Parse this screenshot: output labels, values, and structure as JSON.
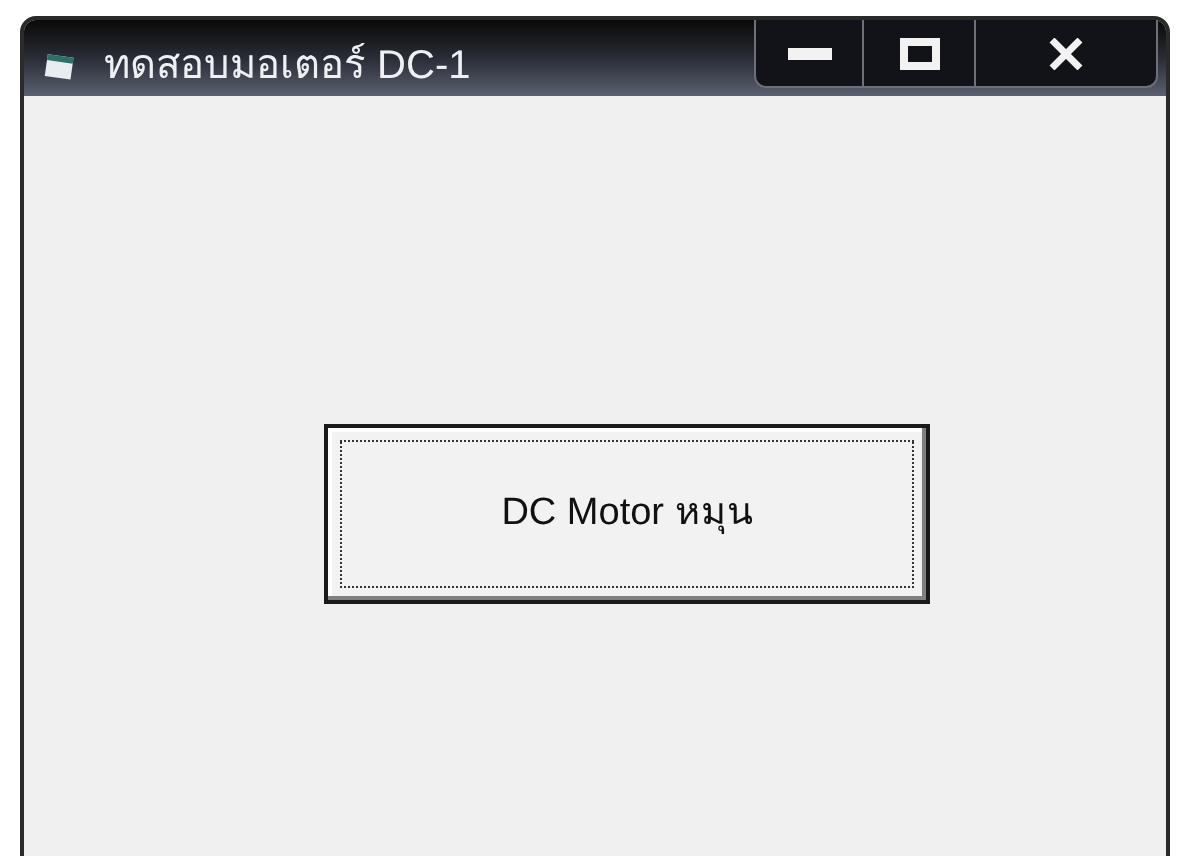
{
  "window": {
    "title": "ทดสอบมอเตอร์ DC-1"
  },
  "button": {
    "label": "DC Motor หมุน",
    "focused": true
  }
}
